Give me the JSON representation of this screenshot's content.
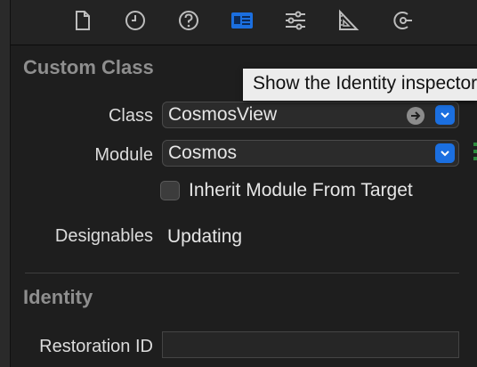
{
  "toolbar": {
    "icons": [
      {
        "name": "file-inspector-icon",
        "active": false
      },
      {
        "name": "history-inspector-icon",
        "active": false
      },
      {
        "name": "quick-help-icon",
        "active": false
      },
      {
        "name": "identity-inspector-icon",
        "active": true
      },
      {
        "name": "attributes-inspector-icon",
        "active": false
      },
      {
        "name": "size-inspector-icon",
        "active": false
      },
      {
        "name": "connections-inspector-icon",
        "active": false
      }
    ],
    "active_color": "#1b6fe0",
    "inactive_color": "#bdbdbd"
  },
  "custom_class": {
    "title": "Custom Class",
    "class_label": "Class",
    "class_value": "CosmosView",
    "module_label": "Module",
    "module_value": "Cosmos",
    "inherit_label": "Inherit Module From Target",
    "inherit_checked": false,
    "designables_label": "Designables",
    "designables_value": "Updating"
  },
  "identity": {
    "title": "Identity",
    "restoration_label": "Restoration ID",
    "restoration_value": ""
  },
  "tooltip": {
    "text": "Show the Identity inspector"
  }
}
